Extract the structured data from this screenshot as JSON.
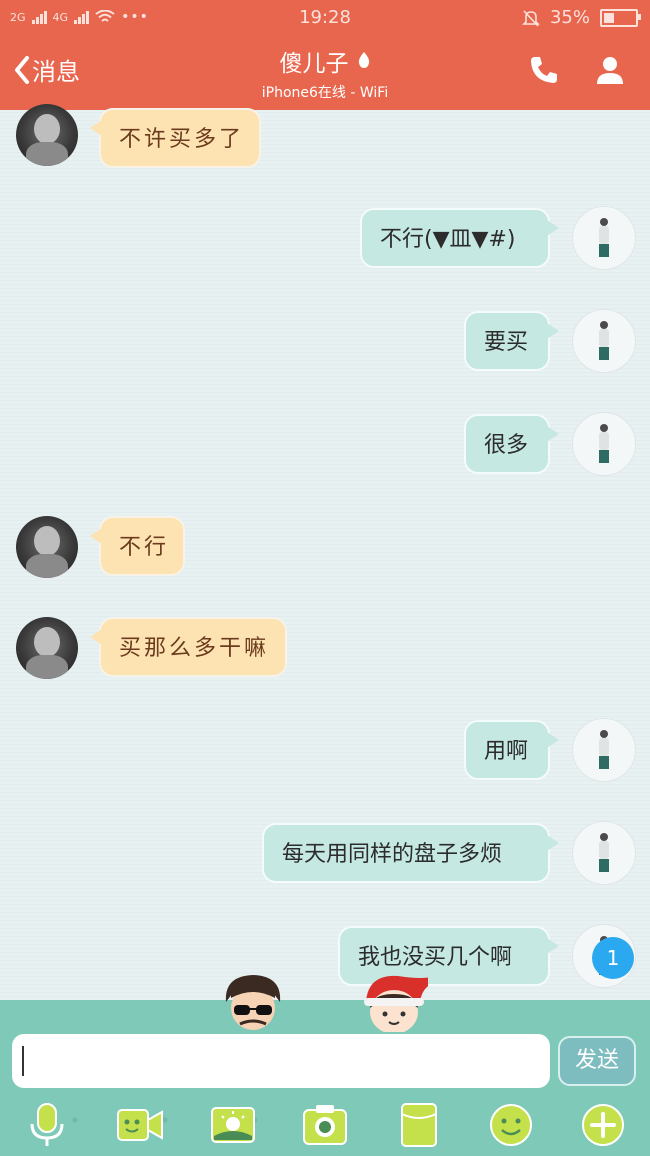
{
  "status_bar": {
    "network1": "2G",
    "network2": "4G",
    "time": "19:28",
    "battery_percent": "35%"
  },
  "header": {
    "back_label": "消息",
    "contact_name": "傻儿子",
    "subtitle": "iPhone6在线 - WiFi"
  },
  "messages": [
    {
      "side": "left",
      "text": "不许买多了"
    },
    {
      "side": "right",
      "text": "不行(▼皿▼#)"
    },
    {
      "side": "right",
      "text": "要买"
    },
    {
      "side": "right",
      "text": "很多"
    },
    {
      "side": "left",
      "text": "不行"
    },
    {
      "side": "left",
      "text": "买那么多干嘛"
    },
    {
      "side": "right",
      "text": "用啊"
    },
    {
      "side": "right",
      "text": "每天用同样的盘子多烦"
    },
    {
      "side": "right",
      "text": "我也没买几个啊"
    }
  ],
  "unread_badge": "1",
  "input": {
    "value": ""
  },
  "send_label": "发送",
  "icons": [
    "back-chevron-icon",
    "flame-icon",
    "phone-icon",
    "profile-icon",
    "microphone-icon",
    "video-call-icon",
    "image-icon",
    "camera-icon",
    "red-packet-icon",
    "emoji-icon",
    "plus-icon"
  ],
  "colors": {
    "header": "#e8664e",
    "incoming_bubble": "#fde2b2",
    "outgoing_bubble": "#c5e8e2",
    "bottom_panel": "#7fc9b8",
    "unread_badge": "#2aa9f0"
  }
}
